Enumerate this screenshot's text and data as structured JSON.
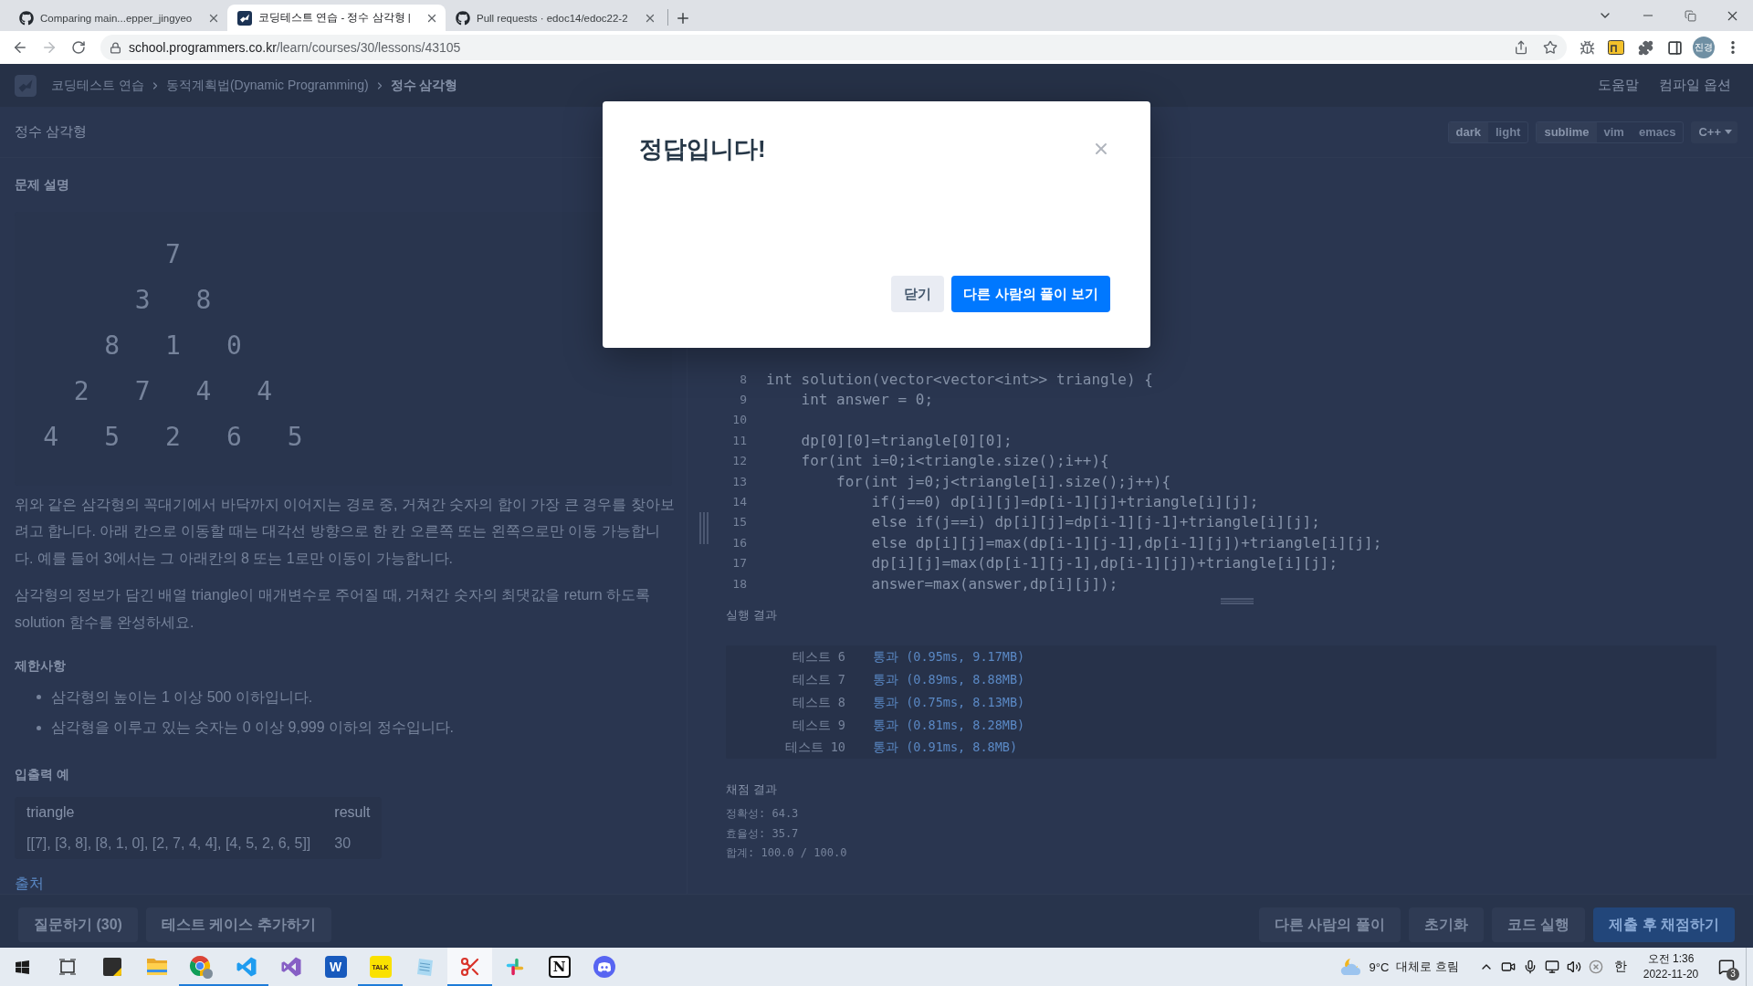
{
  "browser": {
    "tabs": [
      {
        "title": "Comparing main...epper_jingyeo",
        "kind": "github",
        "selected": false
      },
      {
        "title": "코딩테스트 연습 - 정수 삼각형 |",
        "kind": "site",
        "selected": true
      },
      {
        "title": "Pull requests · edoc14/edoc22-2",
        "kind": "github",
        "selected": false
      }
    ],
    "address": {
      "domain": "school.programmers.co.kr",
      "path": "/learn/courses/30/lessons/43105"
    },
    "profile": "진경"
  },
  "header": {
    "breadcrumb": [
      {
        "label": "코딩테스트 연습",
        "current": false
      },
      {
        "label": "동적계획법(Dynamic Programming)",
        "current": false
      },
      {
        "label": "정수 삼각형",
        "current": true
      }
    ],
    "links": [
      "도움말",
      "컴파일 옵션"
    ]
  },
  "editor_options": {
    "themes": [
      {
        "label": "dark",
        "selected": true
      },
      {
        "label": "light",
        "selected": false
      }
    ],
    "keymaps": [
      {
        "label": "sublime",
        "selected": true
      },
      {
        "label": "vim",
        "selected": false
      },
      {
        "label": "emacs",
        "selected": false
      }
    ],
    "language": "C++"
  },
  "problem": {
    "title": "정수 삼각형",
    "description_heading": "문제 설명",
    "triangle": [
      [
        "7"
      ],
      [
        "3",
        "8"
      ],
      [
        "8",
        "1",
        "0"
      ],
      [
        "2",
        "7",
        "4",
        "4"
      ],
      [
        "4",
        "5",
        "2",
        "6",
        "5"
      ]
    ],
    "paragraphs": [
      "위와 같은 삼각형의 꼭대기에서 바닥까지 이어지는 경로 중, 거쳐간 숫자의 합이 가장 큰 경우를 찾아보려고 합니다. 아래 칸으로 이동할 때는 대각선 방향으로 한 칸 오른쪽 또는 왼쪽으로만 이동 가능합니다. 예를 들어 3에서는 그 아래칸의 8 또는 1로만 이동이 가능합니다.",
      "삼각형의 정보가 담긴 배열 triangle이 매개변수로 주어질 때, 거쳐간 숫자의 최댓값을 return 하도록 solution 함수를 완성하세요."
    ],
    "constraints_heading": "제한사항",
    "constraints": [
      "삼각형의 높이는 1 이상 500 이하입니다.",
      "삼각형을 이루고 있는 숫자는 0 이상 9,999 이하의 정수입니다."
    ],
    "examples_heading": "입출력 예",
    "examples": {
      "columns": [
        "triangle",
        "result"
      ],
      "rows": [
        [
          "[[7], [3, 8], [8, 1, 0], [2, 7, 4, 4], [4, 5, 2, 6, 5]]",
          "30"
        ]
      ]
    },
    "source_link": "출처"
  },
  "editor": {
    "lines": [
      {
        "number": "8",
        "code": "int solution(vector<vector<int>> triangle) {"
      },
      {
        "number": "9",
        "code": "    int answer = 0;"
      },
      {
        "number": "10"
      },
      {
        "number": "11",
        "code": "    dp[0][0]=triangle[0][0];"
      },
      {
        "number": "12",
        "code": "    for(int i=0;i<triangle.size();i++){"
      },
      {
        "number": "13",
        "code": "        for(int j=0;j<triangle[i].size();j++){"
      },
      {
        "number": "14",
        "code": "            if(j==0) dp[i][j]=dp[i-1][j]+triangle[i][j];"
      },
      {
        "number": "15",
        "code": "            else if(j==i) dp[i][j]=dp[i-1][j-1]+triangle[i][j];"
      },
      {
        "number": "16",
        "code": "            else dp[i][j]=max(dp[i-1][j-1],dp[i-1][j])+triangle[i][j];"
      },
      {
        "number": "17",
        "code": "            dp[i][j]=max(dp[i-1][j-1],dp[i-1][j])+triangle[i][j];"
      },
      {
        "number": "18",
        "code": "            answer=max(answer,dp[i][j]);"
      }
    ]
  },
  "run_results": {
    "heading": "실행 결과",
    "rows": [
      {
        "label": "테스트 6",
        "result": "통과 (0.95ms, 9.17MB)"
      },
      {
        "label": "테스트 7",
        "result": "통과 (0.89ms, 8.88MB)"
      },
      {
        "label": "테스트 8",
        "result": "통과 (0.75ms, 8.13MB)"
      },
      {
        "label": "테스트 9",
        "result": "통과 (0.81ms, 8.28MB)"
      },
      {
        "label": "테스트 10",
        "result": "통과 (0.91ms, 8.8MB)"
      }
    ]
  },
  "grading": {
    "heading": "채점 결과",
    "lines": [
      "정확성: 64.3",
      "효율성: 35.7",
      "합계: 100.0 / 100.0"
    ]
  },
  "actions": {
    "left": [
      {
        "label": "질문하기 (30)",
        "kind": "secondary"
      },
      {
        "label": "테스트 케이스 추가하기",
        "kind": "secondary"
      }
    ],
    "right": [
      {
        "label": "다른 사람의 풀이",
        "kind": "secondary"
      },
      {
        "label": "초기화",
        "kind": "secondary"
      },
      {
        "label": "코드 실행",
        "kind": "secondary"
      },
      {
        "label": "제출 후 채점하기",
        "kind": "primary"
      }
    ]
  },
  "modal": {
    "title": "정답입니다!",
    "buttons": [
      {
        "label": "닫기",
        "kind": "secondary"
      },
      {
        "label": "다른 사람의 풀이 보기",
        "kind": "primary"
      }
    ]
  },
  "taskbar": {
    "apps": [
      {
        "kind": "sticky_notes",
        "running": false,
        "active": false
      },
      {
        "kind": "file_explorer",
        "running": false,
        "active": false
      },
      {
        "kind": "chrome",
        "running": true,
        "active": false
      },
      {
        "kind": "vscode",
        "running": true,
        "active": false
      },
      {
        "kind": "visual_studio",
        "running": false,
        "active": false
      },
      {
        "kind": "word",
        "label": "W",
        "running": false,
        "active": false
      },
      {
        "kind": "kakaotalk",
        "label": "TALK",
        "running": true,
        "active": false
      },
      {
        "kind": "notepad",
        "running": false,
        "active": false
      },
      {
        "kind": "snipping_tool",
        "running": true,
        "active": true
      },
      {
        "kind": "slack",
        "running": false,
        "active": false
      },
      {
        "kind": "notion",
        "label": "N",
        "running": false,
        "active": false
      },
      {
        "kind": "discord",
        "running": false,
        "active": false
      }
    ],
    "weather": {
      "temperature": "9°C",
      "condition": "대체로 흐림"
    },
    "ime": "한",
    "clock": {
      "time": "오전 1:36",
      "date": "2022-11-20"
    },
    "notifications": "3"
  }
}
